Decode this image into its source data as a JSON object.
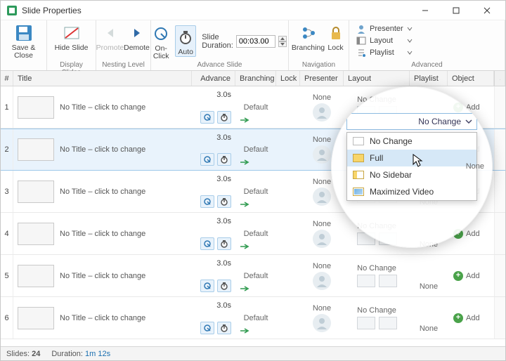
{
  "window": {
    "title": "Slide Properties"
  },
  "ribbon": {
    "save": {
      "save_close": "Save & Close"
    },
    "display": {
      "hide_slide": "Hide Slide",
      "group": "Display Slides"
    },
    "nesting": {
      "promote": "Promote",
      "demote": "Demote",
      "group": "Nesting Level"
    },
    "advance": {
      "onclick": "On-Click",
      "auto": "Auto",
      "dur_label": "Slide Duration:",
      "dur_value": "00:03.00",
      "group": "Advance Slide"
    },
    "nav": {
      "branching": "Branching",
      "lock": "Lock",
      "group": "Navigation"
    },
    "advanced": {
      "presenter": "Presenter",
      "layout": "Layout",
      "playlist": "Playlist",
      "group": "Advanced"
    }
  },
  "columns": {
    "num": "#",
    "title": "Title",
    "advance": "Advance",
    "branching": "Branching",
    "lock": "Lock",
    "presenter": "Presenter",
    "layout": "Layout",
    "playlist": "Playlist",
    "object": "Object"
  },
  "row_defaults": {
    "title": "No Title – click to change",
    "adv_time": "3.0s",
    "branching": "Default",
    "presenter": "None",
    "layout": "No Change",
    "playlist": "None",
    "add": "Add"
  },
  "rows": [
    {
      "num": "1"
    },
    {
      "num": "2",
      "selected": true
    },
    {
      "num": "3"
    },
    {
      "num": "4"
    },
    {
      "num": "5"
    },
    {
      "num": "6"
    }
  ],
  "layout_popup": {
    "combo": "No Change",
    "none_tag": "None",
    "options": [
      {
        "key": "nochg",
        "label": "No Change"
      },
      {
        "key": "full",
        "label": "Full",
        "hover": true
      },
      {
        "key": "nosb",
        "label": "No Sidebar"
      },
      {
        "key": "max",
        "label": "Maximized Video"
      }
    ]
  },
  "status": {
    "slides_label": "Slides:",
    "slides": "24",
    "dur_label": "Duration:",
    "dur": "1m 12s"
  }
}
